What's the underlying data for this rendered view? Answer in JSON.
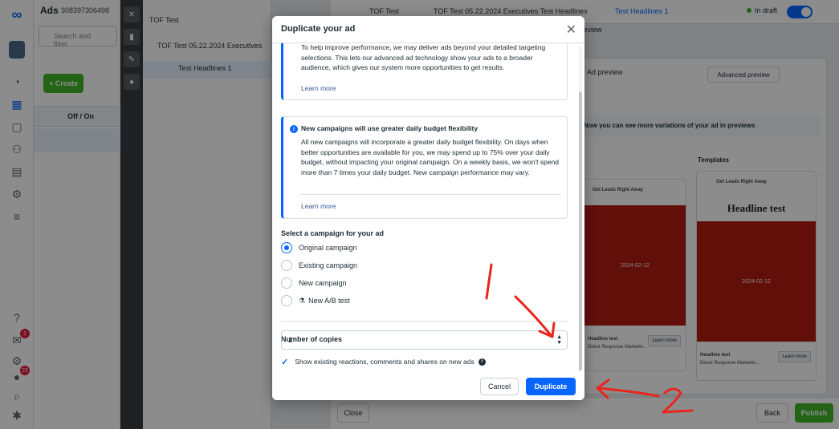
{
  "app": {
    "rail": {
      "badges": [
        "1",
        "22"
      ]
    },
    "left_panel": {
      "title": "Ads",
      "account_id": "308397306498",
      "search_placeholder": "Search and filter",
      "create_label": "+ Create",
      "col_offon": "Off / On"
    },
    "tree": {
      "items": [
        "TOF Test",
        "TOF Test 05.22.2024 Executives",
        "Test Headlines 1"
      ]
    },
    "topbar": {
      "crumbs": [
        "TOF Test",
        "TOF Test 05.22.2024 Executives Test Headlines",
        "Test Headlines 1"
      ],
      "status": "In draft"
    },
    "review_label": "Review",
    "preview": {
      "ad_preview": "Ad preview",
      "advanced_preview": "Advanced preview",
      "info_text": "Now you can see more variations of your ad in previews",
      "templates_label": "Templates",
      "card1_page": "Get Leads Right Away",
      "card2_page": "Get Leads Right Away",
      "headline": "Headline test",
      "date_text": "2024-02-12",
      "learn_more": "Learn more",
      "card_headline": "Headline test",
      "card_sub": "Direct Response Marketin..."
    },
    "bottom": {
      "close_label": "Close",
      "back_label": "Back",
      "publish_label": "Publish"
    }
  },
  "modal": {
    "title": "Duplicate your ad",
    "notice1": {
      "text": "To help improve performance, we may deliver ads beyond your detailed targeting selections. This lets our advanced ad technology show your ads to a broader audience, which gives our system more opportunities to get results.",
      "link": "Learn more"
    },
    "notice2": {
      "title": "New campaigns will use greater daily budget flexibility",
      "text": "All new campaigns will incorporate a greater daily budget flexibility. On days when better opportunities are available for you, we may spend up to 75% over your daily budget, without impacting your original campaign. On a weekly basis, we won't spend more than 7 times your daily budget. New campaign performance may vary.",
      "link": "Learn more"
    },
    "campaign_section": {
      "label": "Select a campaign for your ad",
      "options": [
        "Original campaign",
        "Existing campaign",
        "New campaign",
        "New A/B test"
      ],
      "selected_index": 0
    },
    "copies": {
      "label": "Number of copies",
      "value": "1"
    },
    "checkbox": {
      "label": "Show existing reactions, comments and shares on new ads",
      "checked": true
    },
    "cancel_label": "Cancel",
    "duplicate_label": "Duplicate"
  },
  "annotations": {
    "marks": [
      "1",
      "2"
    ],
    "color": "#e8261c"
  }
}
